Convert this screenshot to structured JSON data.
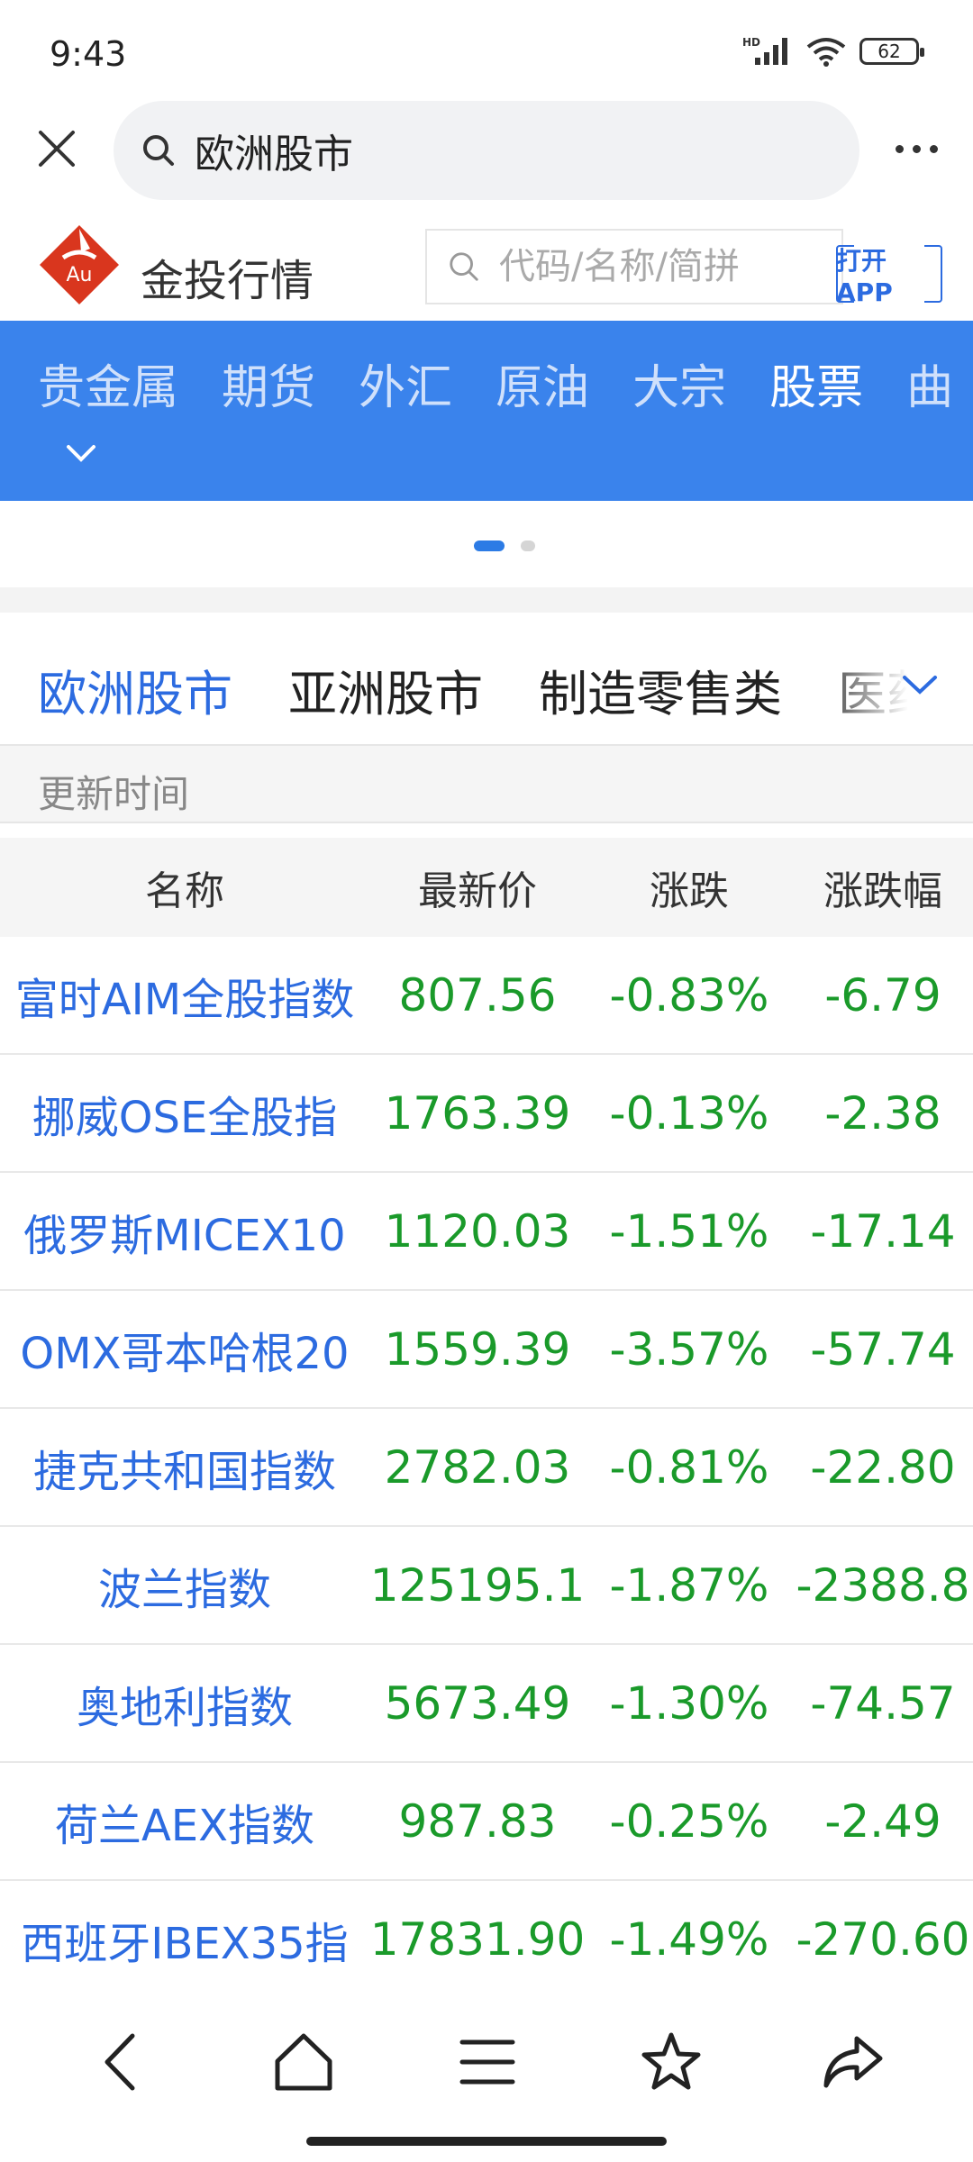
{
  "status_bar": {
    "time": "9:43",
    "hd": "HD",
    "battery": "62"
  },
  "browser": {
    "query": "欧洲股市"
  },
  "site": {
    "name": "金投行情",
    "logo_text": "Au",
    "search_placeholder": "代码/名称/简拼",
    "open_app": "打开APP"
  },
  "nav": {
    "items": [
      "贵金属",
      "期货",
      "外汇",
      "原油",
      "大宗",
      "股票",
      "曲"
    ],
    "active_index": 5
  },
  "carousel": {
    "pages": 2,
    "active": 0
  },
  "categories": {
    "tabs": [
      "欧洲股市",
      "亚洲股市",
      "制造零售类",
      "医药"
    ],
    "active_index": 0
  },
  "update_label": "更新时间",
  "table": {
    "headers": {
      "name": "名称",
      "price": "最新价",
      "change": "涨跌",
      "pct": "涨跌幅"
    },
    "rows": [
      {
        "name": "富时AIM全股指数",
        "price": "807.56",
        "change": "-0.83%",
        "pct": "-6.79"
      },
      {
        "name": "挪威OSE全股指",
        "price": "1763.39",
        "change": "-0.13%",
        "pct": "-2.38"
      },
      {
        "name": "俄罗斯MICEX10",
        "price": "1120.03",
        "change": "-1.51%",
        "pct": "-17.14"
      },
      {
        "name": "OMX哥本哈根20",
        "price": "1559.39",
        "change": "-3.57%",
        "pct": "-57.74"
      },
      {
        "name": "捷克共和国指数",
        "price": "2782.03",
        "change": "-0.81%",
        "pct": "-22.80"
      },
      {
        "name": "波兰指数",
        "price": "125195.1",
        "change": "-1.87%",
        "pct": "-2388.8"
      },
      {
        "name": "奥地利指数",
        "price": "5673.49",
        "change": "-1.30%",
        "pct": "-74.57"
      },
      {
        "name": "荷兰AEX指数",
        "price": "987.83",
        "change": "-0.25%",
        "pct": "-2.49"
      },
      {
        "name": "西班牙IBEX35指",
        "price": "17831.90",
        "change": "-1.49%",
        "pct": "-270.60"
      }
    ]
  },
  "colors": {
    "accent_blue": "#3a83ec",
    "link_blue": "#2c6be0",
    "down_green": "#1a9a2a",
    "logo_red": "#d9361e"
  },
  "bottom_nav": {
    "icons": [
      "back-icon",
      "home-icon",
      "menu-icon",
      "star-icon",
      "share-icon"
    ]
  }
}
